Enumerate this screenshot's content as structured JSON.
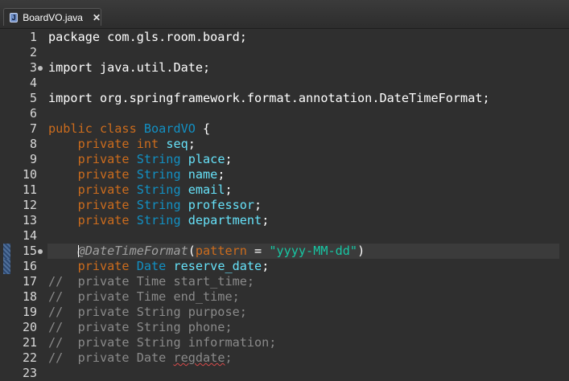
{
  "tab": {
    "icon_letter": "J",
    "title": "BoardVO.java",
    "close_symbol": "✕"
  },
  "lines": [
    {
      "n": "1",
      "tokens": [
        {
          "t": "package com.gls.room.board;",
          "c": "plain"
        }
      ]
    },
    {
      "n": "2",
      "tokens": []
    },
    {
      "n": "3",
      "fold": true,
      "tokens": [
        {
          "t": "import java.util.Date;",
          "c": "plain"
        }
      ]
    },
    {
      "n": "4",
      "tokens": []
    },
    {
      "n": "5",
      "tokens": [
        {
          "t": "import org.springframework.format.annotation.DateTimeFormat;",
          "c": "plain"
        }
      ]
    },
    {
      "n": "6",
      "tokens": []
    },
    {
      "n": "7",
      "tokens": [
        {
          "t": "public class ",
          "c": "kw"
        },
        {
          "t": "BoardVO",
          "c": "typ"
        },
        {
          "t": " {",
          "c": "plain"
        }
      ]
    },
    {
      "n": "8",
      "tokens": [
        {
          "t": "    private int ",
          "c": "kw"
        },
        {
          "t": "seq",
          "c": "fld"
        },
        {
          "t": ";",
          "c": "plain"
        }
      ]
    },
    {
      "n": "9",
      "tokens": [
        {
          "t": "    private ",
          "c": "kw"
        },
        {
          "t": "String ",
          "c": "typ"
        },
        {
          "t": "place",
          "c": "fld"
        },
        {
          "t": ";",
          "c": "plain"
        }
      ]
    },
    {
      "n": "10",
      "tokens": [
        {
          "t": "    private ",
          "c": "kw"
        },
        {
          "t": "String ",
          "c": "typ"
        },
        {
          "t": "name",
          "c": "fld"
        },
        {
          "t": ";",
          "c": "plain"
        }
      ]
    },
    {
      "n": "11",
      "tokens": [
        {
          "t": "    private ",
          "c": "kw"
        },
        {
          "t": "String ",
          "c": "typ"
        },
        {
          "t": "email",
          "c": "fld"
        },
        {
          "t": ";",
          "c": "plain"
        }
      ]
    },
    {
      "n": "12",
      "tokens": [
        {
          "t": "    private ",
          "c": "kw"
        },
        {
          "t": "String ",
          "c": "typ"
        },
        {
          "t": "professor",
          "c": "fld"
        },
        {
          "t": ";",
          "c": "plain"
        }
      ]
    },
    {
      "n": "13",
      "tokens": [
        {
          "t": "    private ",
          "c": "kw"
        },
        {
          "t": "String ",
          "c": "typ"
        },
        {
          "t": "department",
          "c": "fld"
        },
        {
          "t": ";",
          "c": "plain"
        }
      ]
    },
    {
      "n": "14",
      "tokens": []
    },
    {
      "n": "15",
      "fold": true,
      "current": true,
      "marker": true,
      "tokens": [
        {
          "t": "    @DateTimeFormat",
          "c": "ann"
        },
        {
          "t": "(",
          "c": "plain"
        },
        {
          "t": "pattern",
          "c": "kw"
        },
        {
          "t": " = ",
          "c": "plain"
        },
        {
          "t": "\"yyyy-MM-dd\"",
          "c": "str"
        },
        {
          "t": ")",
          "c": "plain"
        }
      ]
    },
    {
      "n": "16",
      "marker": true,
      "tokens": [
        {
          "t": "    private ",
          "c": "kw"
        },
        {
          "t": "Date ",
          "c": "typ"
        },
        {
          "t": "reserve_date",
          "c": "fld"
        },
        {
          "t": ";",
          "c": "plain"
        }
      ]
    },
    {
      "n": "17",
      "tokens": [
        {
          "t": "//  private Time start_time;",
          "c": "cmt"
        }
      ]
    },
    {
      "n": "18",
      "tokens": [
        {
          "t": "//  private Time end_time;",
          "c": "cmt"
        }
      ]
    },
    {
      "n": "19",
      "tokens": [
        {
          "t": "//  private String purpose;",
          "c": "cmt"
        }
      ]
    },
    {
      "n": "20",
      "tokens": [
        {
          "t": "//  private String phone;",
          "c": "cmt"
        }
      ]
    },
    {
      "n": "21",
      "tokens": [
        {
          "t": "//  private String information;",
          "c": "cmt"
        }
      ]
    },
    {
      "n": "22",
      "tokens": [
        {
          "t": "//  private Date ",
          "c": "cmt"
        },
        {
          "t": "regdate",
          "c": "cmt spell"
        },
        {
          "t": ";",
          "c": "cmt"
        }
      ]
    },
    {
      "n": "23",
      "tokens": []
    }
  ]
}
